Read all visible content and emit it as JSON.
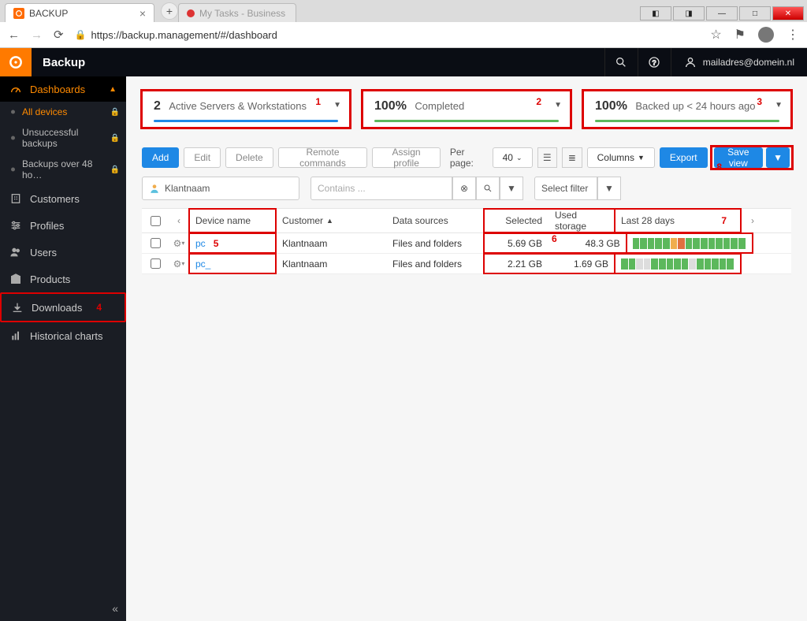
{
  "browser": {
    "tab_title": "BACKUP",
    "ghost_tab_hint": "My Tasks - Business",
    "url": "https://backup.management/#/dashboard"
  },
  "header": {
    "app_title": "Backup",
    "user_email": "mailadres@domein.nl"
  },
  "sidebar": {
    "dashboards": "Dashboards",
    "sub_all_devices": "All devices",
    "sub_unsuccessful": "Unsuccessful backups",
    "sub_48h": "Backups over 48 ho…",
    "customers": "Customers",
    "profiles": "Profiles",
    "users": "Users",
    "products": "Products",
    "downloads": "Downloads",
    "downloads_num": "4",
    "historical": "Historical charts"
  },
  "stats": {
    "card1_num": "2",
    "card1_label": "Active Servers & Workstations",
    "card1_annot": "1",
    "card2_num": "100%",
    "card2_label": "Completed",
    "card2_annot": "2",
    "card3_num": "100%",
    "card3_label": "Backed up < 24 hours ago",
    "card3_annot": "3"
  },
  "toolbar": {
    "add": "Add",
    "edit": "Edit",
    "delete": "Delete",
    "remote": "Remote commands",
    "assign": "Assign profile",
    "per_page_label": "Per page:",
    "per_page_value": "40",
    "columns": "Columns",
    "export": "Export",
    "save_view": "Save view",
    "annot8": "8"
  },
  "filters": {
    "klantnaam": "Klantnaam",
    "contains_placeholder": "Contains ...",
    "select_filter": "Select filter"
  },
  "columns": {
    "device_name": "Device name",
    "customer": "Customer",
    "data_sources": "Data sources",
    "selected": "Selected",
    "used_storage": "Used storage",
    "last28": "Last 28 days",
    "annot5": "5",
    "annot6": "6",
    "annot7": "7"
  },
  "rows": [
    {
      "device": "pc",
      "customer": "Klantnaam",
      "data_sources": "Files and folders",
      "selected": "5.69 GB",
      "used": "48.3 GB",
      "chart": [
        "#5cb85c",
        "#5cb85c",
        "#5cb85c",
        "#5cb85c",
        "#5cb85c",
        "#f0ad4e",
        "#e07040",
        "#5cb85c",
        "#5cb85c",
        "#5cb85c",
        "#5cb85c",
        "#5cb85c",
        "#5cb85c",
        "#5cb85c",
        "#5cb85c"
      ]
    },
    {
      "device": "pc_",
      "customer": "Klantnaam",
      "data_sources": "Files and folders",
      "selected": "2.21 GB",
      "used": "1.69 GB",
      "chart": [
        "#5cb85c",
        "#5cb85c",
        "#ddd",
        "#ddd",
        "#5cb85c",
        "#5cb85c",
        "#5cb85c",
        "#5cb85c",
        "#5cb85c",
        "#ddd",
        "#5cb85c",
        "#5cb85c",
        "#5cb85c",
        "#5cb85c",
        "#5cb85c"
      ]
    }
  ]
}
